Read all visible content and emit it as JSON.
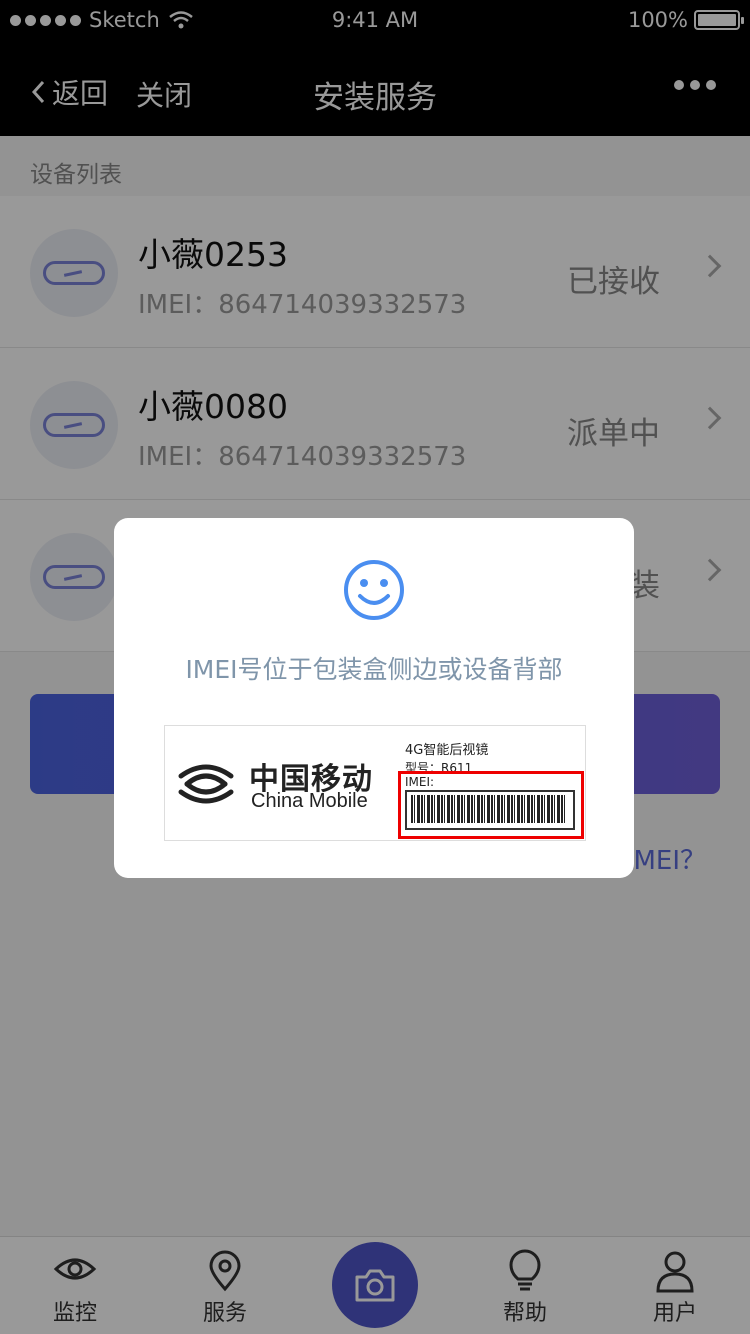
{
  "status_bar": {
    "carrier": "Sketch",
    "time": "9:41 AM",
    "battery": "100%"
  },
  "nav": {
    "back_label": "返回",
    "close_label": "关闭",
    "title": "安装服务"
  },
  "section_label": "设备列表",
  "devices": [
    {
      "name": "小薇0253",
      "imei": "IMEI：864714039332573",
      "status": "已接收"
    },
    {
      "name": "小薇0080",
      "imei": "IMEI：864714039332573",
      "status": "派单中"
    },
    {
      "name": "",
      "imei": "",
      "status": "装"
    }
  ],
  "help_link": "IMEI？",
  "tabs": [
    {
      "label": "监控",
      "icon": "eye-icon"
    },
    {
      "label": "服务",
      "icon": "location-pin-icon"
    },
    {
      "label": "",
      "icon": "camera-icon"
    },
    {
      "label": "帮助",
      "icon": "lightbulb-icon"
    },
    {
      "label": "用户",
      "icon": "user-icon"
    }
  ],
  "modal": {
    "icon": "smiley-icon",
    "message": "IMEI号位于包装盒侧边或设备背部",
    "label_image": {
      "brand_cn": "中国移动",
      "brand_en": "China Mobile",
      "product": "4G智能后视镜",
      "model": "型号：R611",
      "imei_label": "IMEI:"
    }
  },
  "colors": {
    "accent": "#5b6ad8",
    "camera_button": "#4f56c8",
    "modal_message": "#7f95aa",
    "highlight": "#ee0000"
  }
}
